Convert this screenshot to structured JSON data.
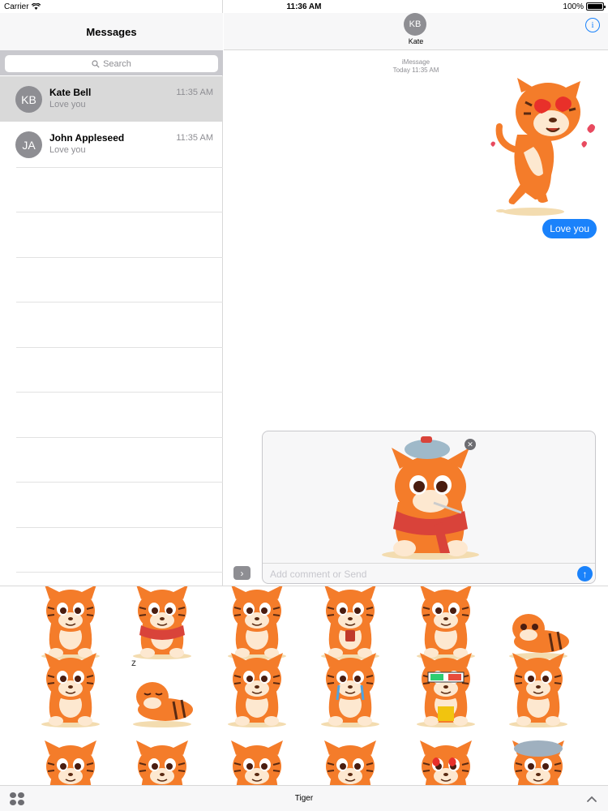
{
  "status_bar": {
    "carrier": "Carrier",
    "time": "11:36 AM",
    "battery_text": "100%",
    "battery_level": 1.0
  },
  "sidebar": {
    "title": "Messages",
    "search_placeholder": "Search",
    "conversations": [
      {
        "initials": "KB",
        "name": "Kate Bell",
        "preview": "Love you",
        "time": "11:35 AM",
        "selected": true
      },
      {
        "initials": "JA",
        "name": "John Appleseed",
        "preview": "Love you",
        "time": "11:35 AM",
        "selected": false
      }
    ]
  },
  "chat": {
    "contact_initials": "KB",
    "contact_name": "Kate",
    "info_icon": "info-icon",
    "service": "iMessage",
    "timestamp": "Today 11:35 AM",
    "sent_message": "Love you",
    "sent_sticker": "tiger-love-sticker"
  },
  "compose": {
    "placeholder": "Add comment or Send",
    "expand_icon": "chevron-right-icon",
    "send_icon": "arrow-up-icon",
    "remove_icon": "close-icon",
    "attached_sticker": "tiger-sick-sticker"
  },
  "sticker_drawer": {
    "app_name": "Tiger",
    "apps_icon": "app-grid-icon",
    "collapse_icon": "chevron-up-icon",
    "stickers": [
      "tiger-running",
      "tiger-sick",
      "tiger-thinking",
      "tiger-drinking",
      "tiger-thumbs-up",
      "tiger-lying",
      "tiger-laughing",
      "tiger-sleeping",
      "tiger-sad",
      "tiger-crying",
      "tiger-3d-glasses",
      "tiger-pensive",
      "tiger-surprised",
      "tiger-wink",
      "tiger-smile",
      "tiger-grin",
      "tiger-in-love",
      "tiger-snow-hat"
    ]
  },
  "colors": {
    "accent": "#1a82fb",
    "tiger_orange": "#f47c2a",
    "selected_row": "#d9d9d9"
  }
}
